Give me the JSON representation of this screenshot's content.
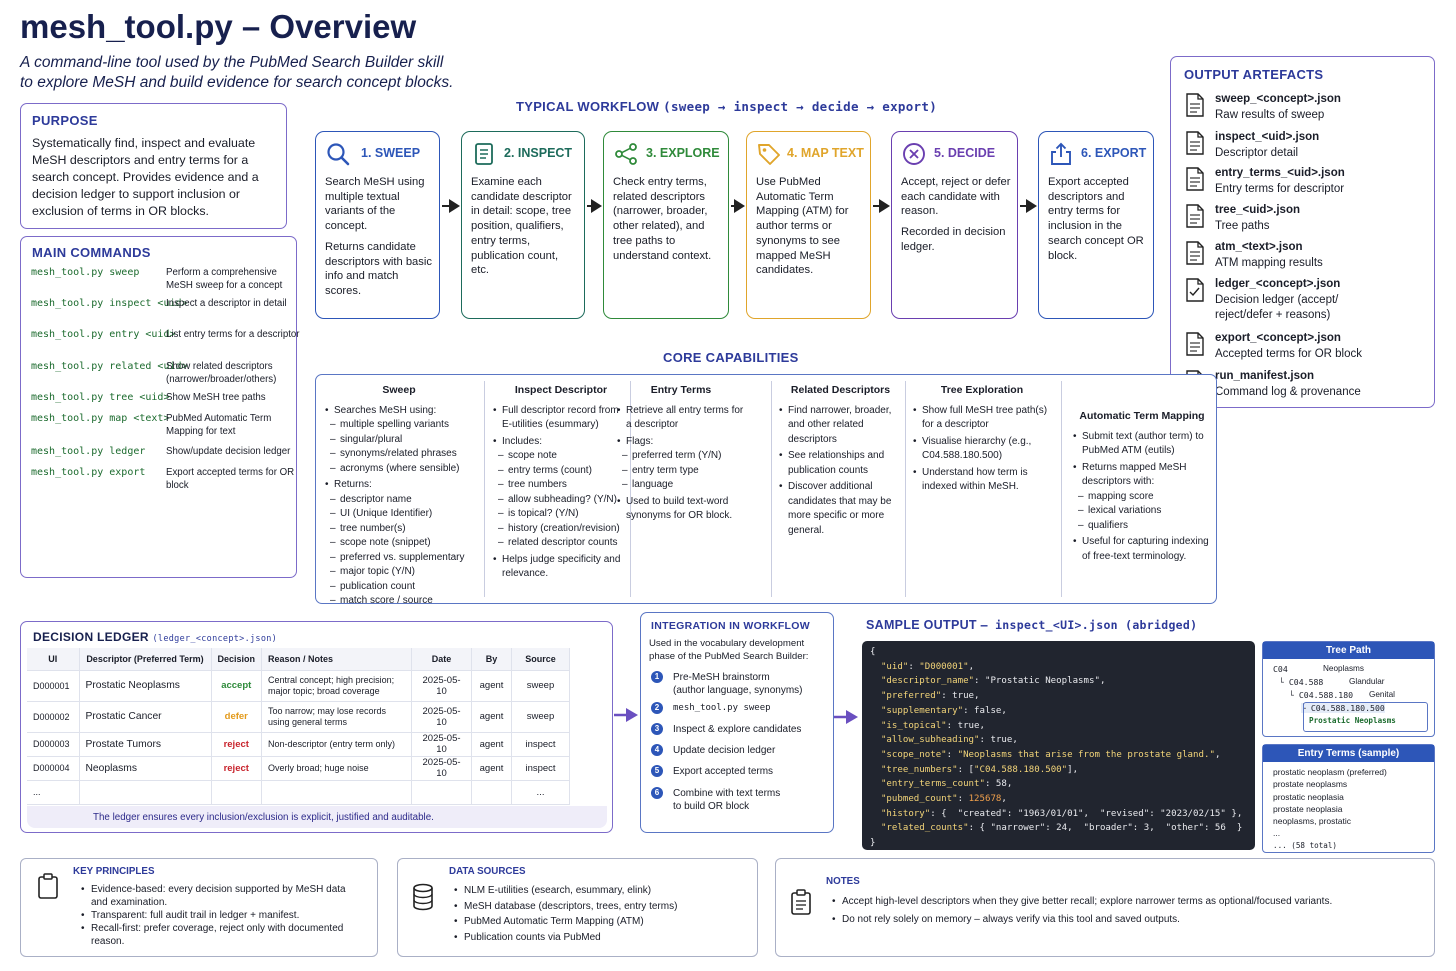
{
  "header": {
    "title": "mesh_tool.py – Overview",
    "subtitle_line1": "A command-line tool used by the PubMed Search Builder skill",
    "subtitle_line2": "to explore MeSH and build evidence for search concept blocks."
  },
  "purpose": {
    "heading": "PURPOSE",
    "text": "Systematically find, inspect and evaluate MeSH descriptors and entry terms for a search concept. Provides evidence and a decision ledger to support inclusion or exclusion of terms in OR blocks."
  },
  "commands": {
    "heading": "MAIN COMMANDS",
    "items": [
      {
        "code": "mesh_tool.py sweep",
        "desc": "Perform a comprehensive MeSH sweep for a concept"
      },
      {
        "code": "mesh_tool.py inspect <uid>",
        "desc": "Inspect a descriptor in detail"
      },
      {
        "code": "mesh_tool.py entry <uid>",
        "desc": "List entry terms for a descriptor"
      },
      {
        "code": "mesh_tool.py related <uid>",
        "desc": "Show related descriptors (narrower/broader/others)"
      },
      {
        "code": "mesh_tool.py tree <uid>",
        "desc": "Show MeSH tree paths"
      },
      {
        "code": "mesh_tool.py map <text>",
        "desc": "PubMed Automatic Term Mapping for text"
      },
      {
        "code": "mesh_tool.py ledger",
        "desc": "Show/update decision ledger"
      },
      {
        "code": "mesh_tool.py export",
        "desc": "Export accepted terms for OR block"
      }
    ]
  },
  "workflow": {
    "heading": "TYPICAL WORKFLOW",
    "heading_code": "(sweep → inspect → decide → export)",
    "steps": [
      {
        "label": "1. SWEEP",
        "color": "#2d56b8",
        "icon": "magnifier-icon",
        "body": "Search MeSH using multiple textual variants of the concept.",
        "body2": "Returns candidate descriptors with basic info and match scores."
      },
      {
        "label": "2. INSPECT",
        "color": "#1d6b5b",
        "icon": "document-icon",
        "body": "Examine each candidate descriptor in detail: scope, tree position, qualifiers, entry terms, publication count, etc.",
        "body2": ""
      },
      {
        "label": "3. EXPLORE",
        "color": "#2f8a3a",
        "icon": "share-nodes-icon",
        "body": "Check entry terms, related descriptors (narrower, broader, other related), and tree paths to understand context.",
        "body2": ""
      },
      {
        "label": "4. MAP TEXT",
        "color": "#e0a52b",
        "icon": "tag-icon",
        "body": "Use PubMed Automatic Term Mapping (ATM) for author terms or synonyms to see mapped MeSH candidates.",
        "body2": ""
      },
      {
        "label": "5. DECIDE",
        "color": "#6a3fb0",
        "icon": "x-circle-icon",
        "body": "Accept, reject or defer each candidate with reason.",
        "body2": "Recorded in decision ledger."
      },
      {
        "label": "6. EXPORT",
        "color": "#2d56b8",
        "icon": "export-icon",
        "body": "Export accepted descriptors and entry terms for inclusion in the search concept OR block.",
        "body2": ""
      }
    ]
  },
  "artefacts": {
    "heading": "OUTPUT ARTEFACTS",
    "items": [
      {
        "name": "sweep_<concept>.json",
        "desc": "Raw results of sweep"
      },
      {
        "name": "inspect_<uid>.json",
        "desc": "Descriptor detail"
      },
      {
        "name": "entry_terms_<uid>.json",
        "desc": "Entry terms for descriptor"
      },
      {
        "name": "tree_<uid>.json",
        "desc": "Tree paths"
      },
      {
        "name": "atm_<text>.json",
        "desc": "ATM mapping results"
      },
      {
        "name": "ledger_<concept>.json",
        "desc": "Decision ledger (accept/ reject/defer + reasons)"
      },
      {
        "name": "export_<concept>.json",
        "desc": "Accepted terms for OR block"
      },
      {
        "name": "run_manifest.json",
        "desc": "Command log & provenance"
      }
    ]
  },
  "capabilities": {
    "heading": "CORE CAPABILITIES",
    "columns": [
      {
        "title": "Sweep",
        "items": [
          [
            "b",
            "Searches MeSH using:"
          ],
          [
            "s",
            "multiple spelling variants"
          ],
          [
            "s",
            "singular/plural"
          ],
          [
            "s",
            "synonyms/related phrases"
          ],
          [
            "s",
            "acronyms (where sensible)"
          ],
          [
            "b",
            "Returns:"
          ],
          [
            "s",
            "descriptor name"
          ],
          [
            "s",
            "UI (Unique Identifier)"
          ],
          [
            "s",
            "tree number(s)"
          ],
          [
            "s",
            "scope note (snippet)"
          ],
          [
            "s",
            "preferred vs. supplementary"
          ],
          [
            "s",
            "major topic (Y/N)"
          ],
          [
            "s",
            "publication count"
          ],
          [
            "s",
            "match score / source"
          ]
        ]
      },
      {
        "title": "Inspect Descriptor",
        "items": [
          [
            "b",
            "Full descriptor record from E-utilities (esummary)"
          ],
          [
            "b",
            "Includes:"
          ],
          [
            "s",
            "scope note"
          ],
          [
            "s",
            "entry terms (count)"
          ],
          [
            "s",
            "tree numbers"
          ],
          [
            "s",
            "allow subheading? (Y/N)"
          ],
          [
            "s",
            "is topical? (Y/N)"
          ],
          [
            "s",
            "history (creation/revision)"
          ],
          [
            "s",
            "related descriptor counts"
          ],
          [
            "b",
            "Helps judge specificity and relevance."
          ]
        ]
      },
      {
        "title": "Entry Terms",
        "items": [
          [
            "b",
            "Retrieve all entry terms for a descriptor"
          ],
          [
            "b",
            "Flags:"
          ],
          [
            "s",
            "preferred term (Y/N)"
          ],
          [
            "s",
            "entry term type"
          ],
          [
            "s",
            "language"
          ],
          [
            "b",
            "Used to build text-word synonyms for OR block."
          ]
        ]
      },
      {
        "title": "Related Descriptors",
        "items": [
          [
            "b",
            "Find narrower, broader, and other related descriptors"
          ],
          [
            "b",
            "See relationships and publication counts"
          ],
          [
            "b",
            "Discover additional candidates that may be more specific or more general."
          ]
        ]
      },
      {
        "title": "Tree Exploration",
        "items": [
          [
            "b",
            "Show full MeSH tree path(s) for a descriptor"
          ],
          [
            "b",
            "Visualise hierarchy (e.g., C04.588.180.500)"
          ],
          [
            "b",
            "Understand how term is indexed within MeSH."
          ]
        ]
      },
      {
        "title": "Automatic Term Mapping",
        "items": [
          [
            "b",
            "Submit text (author term) to PubMed ATM (eutils)"
          ],
          [
            "b",
            "Returns mapped MeSH descriptors with:"
          ],
          [
            "s",
            "mapping score"
          ],
          [
            "s",
            "lexical variations"
          ],
          [
            "s",
            "qualifiers"
          ],
          [
            "b",
            "Useful for capturing indexing of free-text terminology."
          ]
        ]
      }
    ]
  },
  "ledger": {
    "heading": "DECISION LEDGER",
    "heading_code": "(ledger_<concept>.json)",
    "columns": [
      "UI",
      "Descriptor (Preferred Term)",
      "Decision",
      "Reason / Notes",
      "Date",
      "By",
      "Source"
    ],
    "rows": [
      {
        "ui": "D000001",
        "name": "Prostatic Neoplasms",
        "decision": "accept",
        "dcolor": "#2e8a3a",
        "reason": "Central concept; high precision; major topic; broad coverage",
        "date": "2025-05-10",
        "by": "agent",
        "source": "sweep"
      },
      {
        "ui": "D000002",
        "name": "Prostatic Cancer",
        "decision": "defer",
        "dcolor": "#e39a1b",
        "reason": "Too narrow; may lose records using general terms",
        "date": "2025-05-10",
        "by": "agent",
        "source": "sweep"
      },
      {
        "ui": "D000003",
        "name": "Prostate Tumors",
        "decision": "reject",
        "dcolor": "#c8242d",
        "reason": "Non-descriptor (entry term only)",
        "date": "2025-05-10",
        "by": "agent",
        "source": "inspect"
      },
      {
        "ui": "D000004",
        "name": "Neoplasms",
        "decision": "reject",
        "dcolor": "#c8242d",
        "reason": "Overly broad; huge noise",
        "date": "2025-05-10",
        "by": "agent",
        "source": "inspect"
      },
      {
        "ui": "...",
        "name": "",
        "decision": "",
        "dcolor": "#000",
        "reason": "",
        "date": "",
        "by": "",
        "source": "..."
      }
    ],
    "footer": "The ledger ensures every inclusion/exclusion is explicit, justified and auditable."
  },
  "integration": {
    "heading": "INTEGRATION IN WORKFLOW",
    "intro": "Used in the vocabulary development phase of the PubMed Search Builder:",
    "steps": [
      {
        "num": "1",
        "text": "Pre-MeSH brainstorm",
        "text2": "(author language, synonyms)",
        "mono": false
      },
      {
        "num": "2",
        "text": "mesh_tool.py sweep",
        "text2": "",
        "mono": true
      },
      {
        "num": "3",
        "text": "Inspect & explore candidates",
        "text2": "",
        "mono": false
      },
      {
        "num": "4",
        "text": "Update decision ledger",
        "text2": "",
        "mono": false
      },
      {
        "num": "5",
        "text": "Export accepted terms",
        "text2": "",
        "mono": false
      },
      {
        "num": "6",
        "text": "Combine with text terms",
        "text2": "to build OR block",
        "mono": false
      }
    ]
  },
  "sample": {
    "heading": "SAMPLE OUTPUT",
    "heading_code": "– inspect_<UI>.json (abridged)"
  },
  "tree_path": {
    "heading": "Tree Path",
    "rows": [
      {
        "code": "C04",
        "label": "Neoplasms"
      },
      {
        "code": "└ C04.588",
        "label": "Glandular"
      },
      {
        "code": "└ C04.588.180",
        "label": "Genital"
      },
      {
        "code": "└ C04.588.180.500",
        "label": "Prostatic Neoplasms"
      }
    ]
  },
  "entry_terms": {
    "heading": "Entry Terms (sample)",
    "items": [
      "prostatic neoplasm (preferred)",
      "prostate neoplasms",
      "prostatic neoplasia",
      "prostate neoplasia",
      "neoplasms, prostatic",
      "...",
      "... (58 total)"
    ]
  },
  "principles": {
    "heading": "KEY PRINCIPLES",
    "items": [
      "Evidence-based: every decision supported by MeSH data and examination.",
      "Transparent: full audit trail in ledger + manifest.",
      "Recall-first: prefer coverage, reject only with documented reason."
    ]
  },
  "sources": {
    "heading": "DATA SOURCES",
    "items": [
      "NLM E-utilities (esearch, esummary, elink)",
      "MeSH database (descriptors, trees, entry terms)",
      "PubMed Automatic Term Mapping (ATM)",
      "Publication counts via PubMed"
    ]
  },
  "notes": {
    "heading": "NOTES",
    "items": [
      "Accept high-level descriptors when they give better recall; explore narrower terms as optional/focused variants.",
      "Do not rely solely on memory – always verify via this tool and saved outputs."
    ]
  }
}
